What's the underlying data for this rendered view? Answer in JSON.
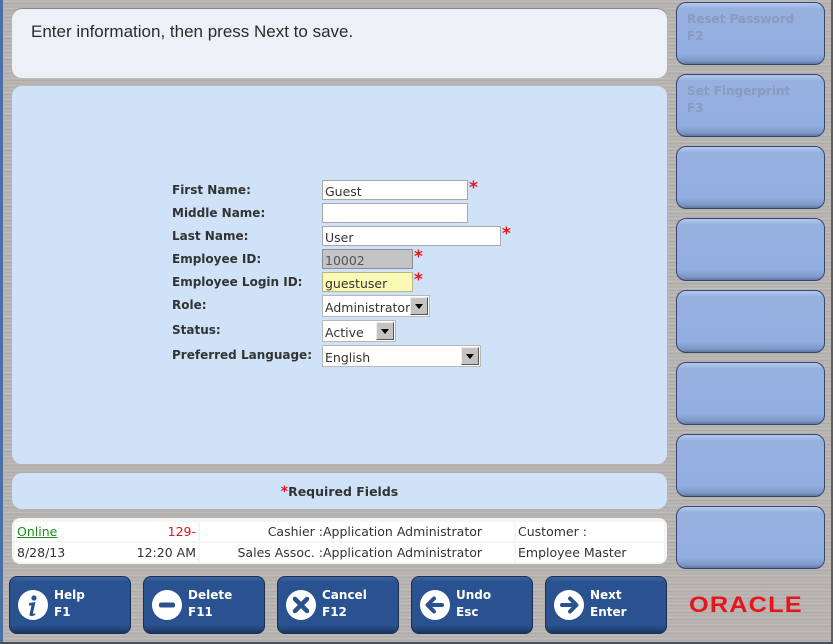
{
  "prompt": {
    "text": "Enter information, then press Next to save."
  },
  "form": {
    "fields": [
      {
        "label": "First Name:",
        "value": "Guest",
        "required": true
      },
      {
        "label": "Middle Name:",
        "value": "",
        "required": false
      },
      {
        "label": "Last Name:",
        "value": "User",
        "required": true
      },
      {
        "label": "Employee ID:",
        "value": "10002",
        "required": true,
        "readonly": true
      },
      {
        "label": "Employee Login ID:",
        "value": "guestuser",
        "required": true,
        "focused": true
      },
      {
        "label": "Role:",
        "value": "Administrator",
        "type": "select"
      },
      {
        "label": "Status:",
        "value": "Active",
        "type": "select"
      },
      {
        "label": "Preferred Language:",
        "value": "English",
        "type": "select"
      }
    ],
    "required_star": "*"
  },
  "required_note": {
    "star": "*",
    "text": "Required Fields"
  },
  "status_bar": {
    "online": "Online",
    "transaction": "129-",
    "cashier_label": "Cashier :",
    "cashier_value": "Application Administrator",
    "customer_label": "Customer :",
    "date": "8/28/13",
    "time": "12:20 AM",
    "sales_assoc_label": "Sales Assoc. :",
    "sales_assoc_value": "Application Administrator",
    "screen_name": "Employee Master"
  },
  "side_buttons": [
    {
      "label": "Reset Password",
      "key": "F2",
      "enabled": false
    },
    {
      "label": "Set Fingerprint",
      "key": "F3",
      "enabled": false
    },
    {
      "label": "",
      "key": ""
    },
    {
      "label": "",
      "key": ""
    },
    {
      "label": "",
      "key": ""
    },
    {
      "label": "",
      "key": ""
    },
    {
      "label": "",
      "key": ""
    },
    {
      "label": "",
      "key": ""
    }
  ],
  "bottom_buttons": [
    {
      "label": "Help",
      "key": "F1",
      "icon": "info-icon"
    },
    {
      "label": "Delete",
      "key": "F11",
      "icon": "minus-circle-icon"
    },
    {
      "label": "Cancel",
      "key": "F12",
      "icon": "x-circle-icon"
    },
    {
      "label": "Undo",
      "key": "Esc",
      "icon": "arrow-left-icon"
    },
    {
      "label": "Next",
      "key": "Enter",
      "icon": "arrow-right-icon"
    }
  ],
  "brand": {
    "logo_text": "ORACLE",
    "color": "#e8141c"
  },
  "colors": {
    "panel_blue": "#cfe2f7",
    "button_navy": "#2a5290",
    "side_button_blue": "#92aee0",
    "required_red": "#e8141c",
    "online_green": "#1a8c1a",
    "login_focus_yellow": "#fafab4"
  }
}
